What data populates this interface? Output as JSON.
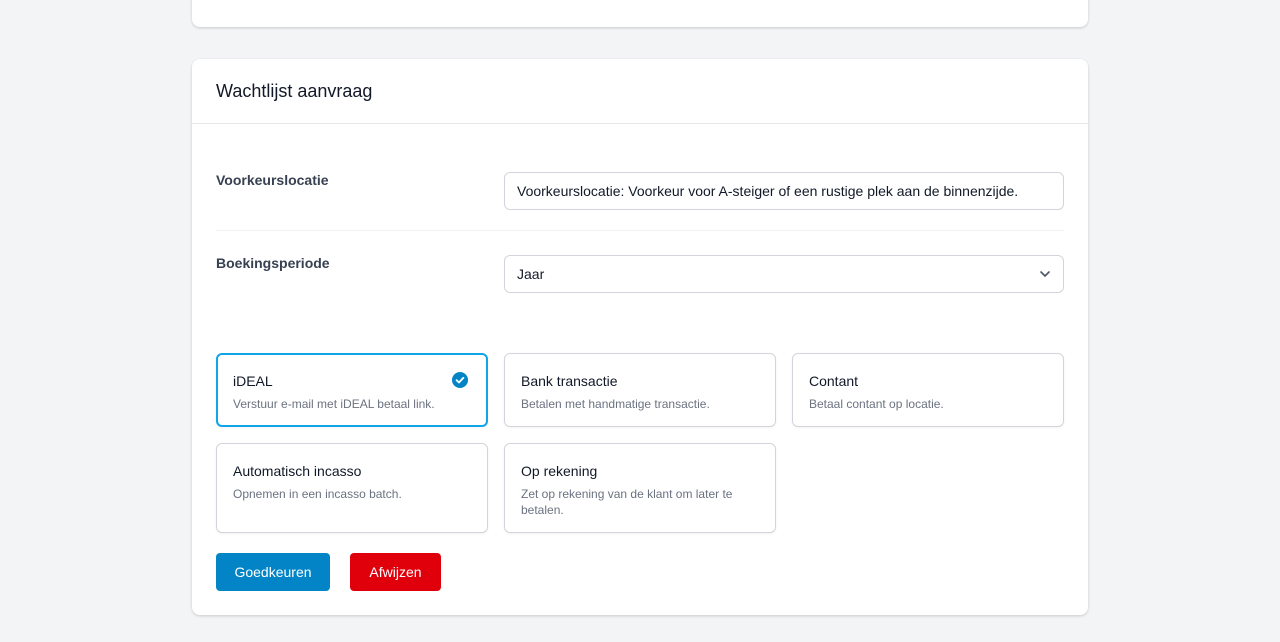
{
  "card": {
    "title": "Wachtlijst aanvraag"
  },
  "fields": {
    "location": {
      "label": "Voorkeurslocatie",
      "value": "Voorkeurslocatie: Voorkeur voor A-steiger of een rustige plek aan de binnenzijde."
    },
    "period": {
      "label": "Boekingsperiode",
      "selected": "Jaar"
    }
  },
  "payment_options": [
    {
      "title": "iDEAL",
      "description": "Verstuur e-mail met iDEAL betaal link.",
      "selected": true
    },
    {
      "title": "Bank transactie",
      "description": "Betalen met handmatige transactie.",
      "selected": false
    },
    {
      "title": "Contant",
      "description": "Betaal contant op locatie.",
      "selected": false
    },
    {
      "title": "Automatisch incasso",
      "description": "Opnemen in een incasso batch.",
      "selected": false
    },
    {
      "title": "Op rekening",
      "description": "Zet op rekening van de klant om later te betalen.",
      "selected": false
    }
  ],
  "actions": {
    "approve_label": "Goedkeuren",
    "reject_label": "Afwijzen"
  },
  "colors": {
    "approve": "#0284c7",
    "reject": "#e0000b",
    "selected_border": "#0ea5e9"
  }
}
